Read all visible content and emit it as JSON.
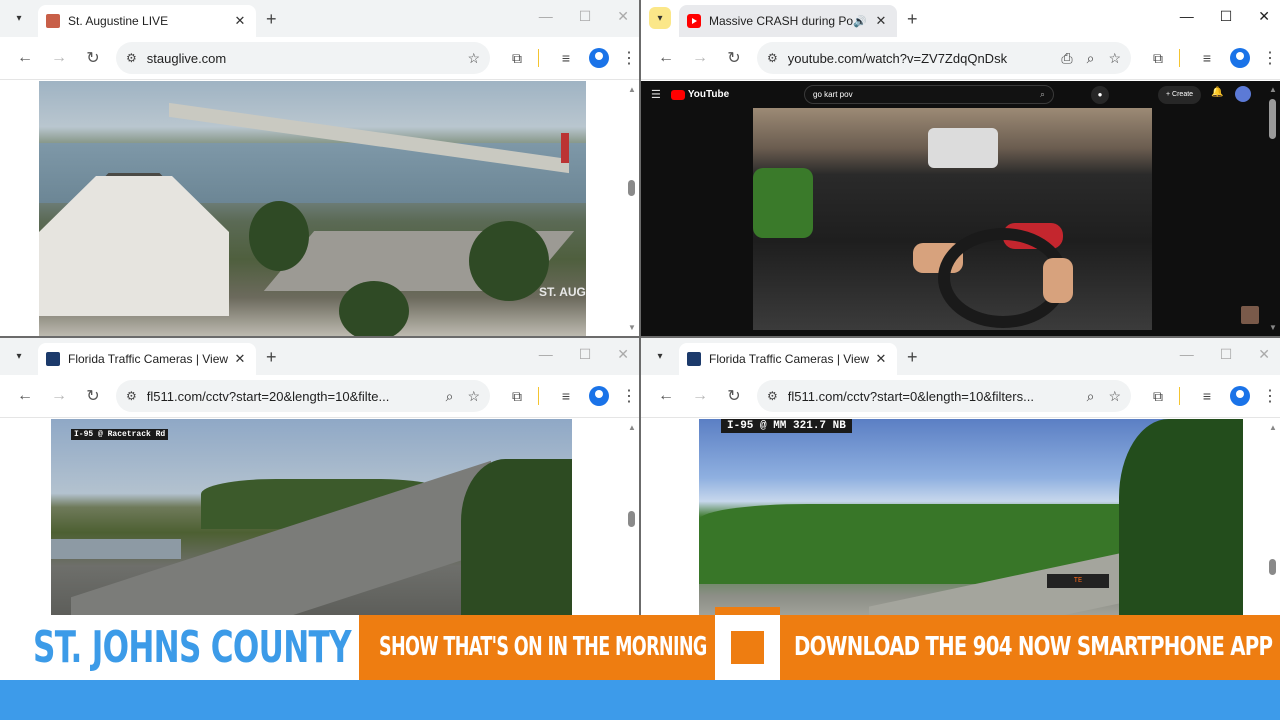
{
  "windows": {
    "top_left": {
      "tab_title": "St. Augustine LIVE",
      "url": "stauglive.com",
      "cam_logo": "ST. AUG"
    },
    "top_right": {
      "tab_title": "Massive CRASH during Poli",
      "url": "youtube.com/watch?v=ZV7ZdqQnDsk",
      "youtube": {
        "logo_text": "YouTube",
        "search_value": "go kart pov",
        "create_label": "Create"
      }
    },
    "bottom_left": {
      "tab_title": "Florida Traffic Cameras | View L",
      "url": "fl511.com/cctv?start=20&length=10&filte...",
      "cam_label": "I-95 @ Racetrack Rd"
    },
    "bottom_right": {
      "tab_title": "Florida Traffic Cameras | View L",
      "url": "fl511.com/cctv?start=0&length=10&filters...",
      "cam_label": "I-95 @ MM 321.7 NB",
      "sign_text": "TE"
    }
  },
  "banner": {
    "county": "ST. JOHNS COUNTY",
    "show": "SHOW THAT'S ON IN THE MORNING",
    "download": "DOWNLOAD THE 904 NOW SMARTPHONE APP"
  },
  "colors": {
    "banner_orange": "#ee7d11",
    "banner_blue": "#3c9be8",
    "bottom_bar_blue": "#3d9bea"
  },
  "icons": [
    "chevron-down-icon",
    "close-icon",
    "plus-icon",
    "minimize-icon",
    "maximize-icon",
    "back-arrow-icon",
    "forward-arrow-icon",
    "reload-icon",
    "site-info-icon",
    "star-icon",
    "extensions-icon",
    "media-icon",
    "profile-icon",
    "menu-dots-icon",
    "zoom-icon",
    "install-icon",
    "speaker-icon"
  ]
}
